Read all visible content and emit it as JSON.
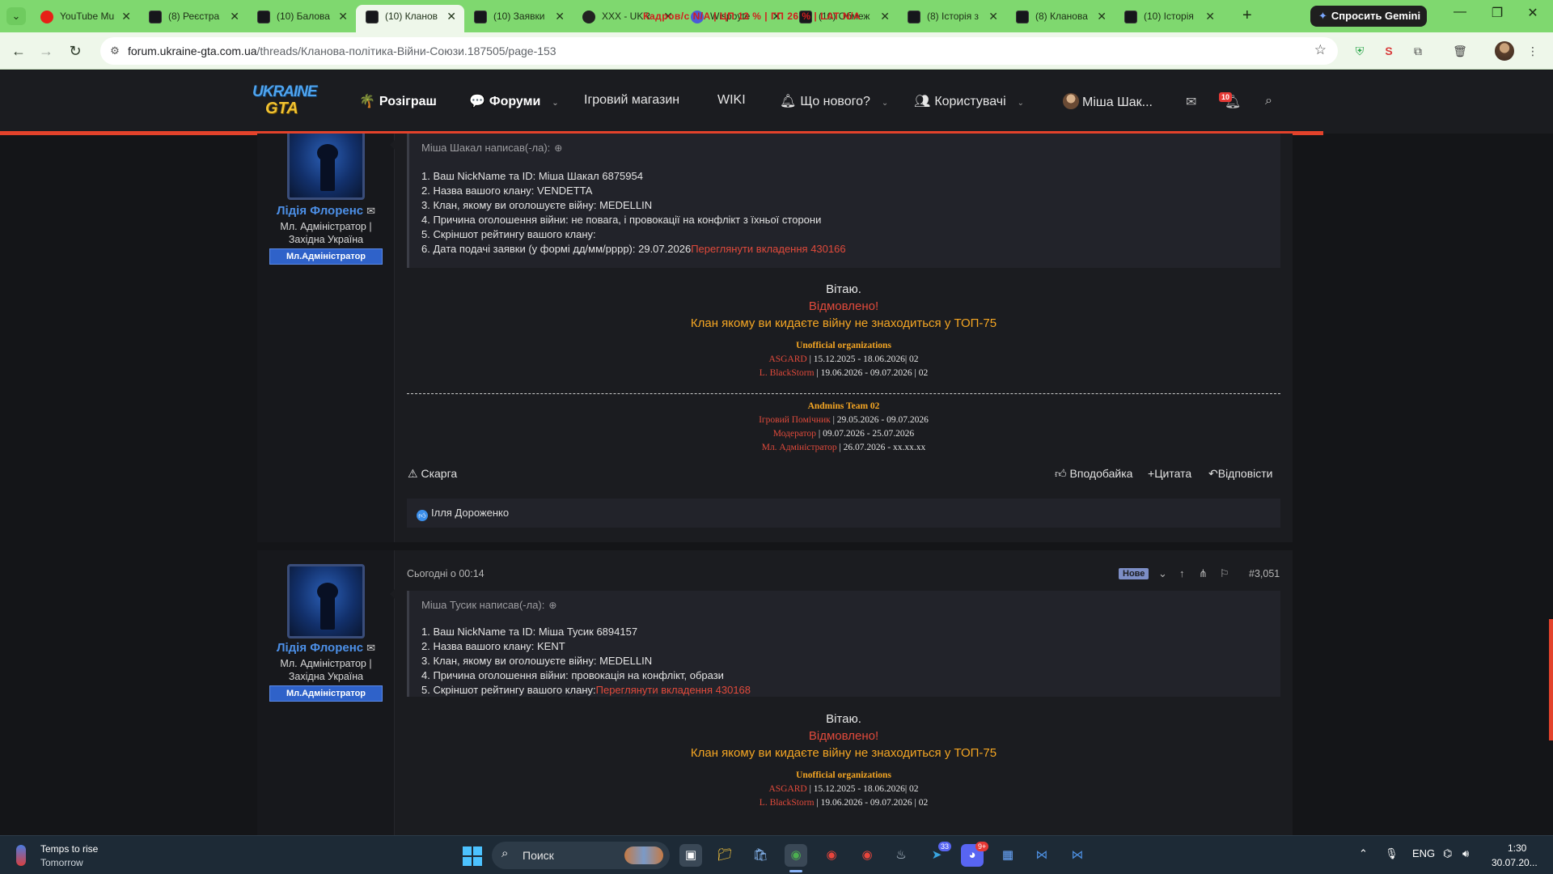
{
  "browser": {
    "tabs": [
      {
        "label": "YouTube Mu",
        "icon": "youtube-icon"
      },
      {
        "label": "(8) Реєстра",
        "icon": "forum-icon"
      },
      {
        "label": "(10) Балова",
        "icon": "forum-icon"
      },
      {
        "label": "(10) Кланов",
        "icon": "forum-icon",
        "active": true
      },
      {
        "label": "(10) Заявки",
        "icon": "forum-icon"
      },
      {
        "label": "XXX - UKR",
        "icon": "github-icon"
      },
      {
        "label": "Wispbyte",
        "icon": "wispbyte-icon"
      },
      {
        "label": "(10) Обмеж",
        "icon": "forum-icon"
      },
      {
        "label": "(8) Історія з",
        "icon": "forum-icon"
      },
      {
        "label": "(8) Кланова",
        "icon": "forum-icon"
      },
      {
        "label": "(10) Історія",
        "icon": "forum-icon"
      }
    ],
    "overlay_text": "Кадров/с  N/A  |  ЦП 13 %  |  ГП 26 %  |  LAT  N/A",
    "gemini_label": "Спросить Gemini",
    "url_domain": "forum.ukraine-gta.com.ua",
    "url_path": "/threads/Кланова-політика-Війни-Союзи.187505/page-153"
  },
  "forum_nav": {
    "logo_top": "UKRAINE",
    "logo_bottom": "GTA",
    "items": [
      {
        "label": "Розіграш",
        "icon": "palm-icon"
      },
      {
        "label": "Форуми",
        "icon": "chat-icon"
      },
      {
        "label": "Ігровий магазин"
      },
      {
        "label": "WIKI"
      },
      {
        "label": "Що нового?",
        "icon": "bell-icon"
      },
      {
        "label": "Користувачі",
        "icon": "users-icon"
      }
    ],
    "username": "Міша Шак...",
    "notifications_count": "10"
  },
  "posts": [
    {
      "author": "Лідія Флоренс",
      "author_title_line1": "Мл. Адміністратор |",
      "author_title_line2": "Західна Україна",
      "banner": "Мл.Адміністратор",
      "quote_header": "Міша Шакал написав(-ла):",
      "quote_lines": [
        "1. Ваш NickName та ID: Міша Шакал 6875954",
        "2. Назва вашого клану: VENDETTA",
        "3. Клан, якому ви оголошуєте війну: MEDELLIN",
        "4. Причина оголошення війни: не повага, і провокації на конфлікт з їхньої сторони",
        "5. Скріншот рейтингу вашого клану:",
        "6. Дата подачі заявки (у формі дд/мм/рррр): 29.07.2026"
      ],
      "attachment_link": "Переглянути вкладення 430166",
      "greeting": "Вітаю.",
      "verdict": "Відмовлено!",
      "reason": "Клан якому ви кидаєте війну не знаходиться у ТОП-75",
      "actions": {
        "report": "Скарга",
        "like": "Вподобайка",
        "quote": "Цитата",
        "reply": "Відповісти"
      },
      "reactions": "Ілля Дороженко"
    },
    {
      "date": "Сьогодні о 00:14",
      "badge": "Нове",
      "number": "#3,051",
      "author": "Лідія Флоренс",
      "author_title_line1": "Мл. Адміністратор |",
      "author_title_line2": "Західна Україна",
      "banner": "Мл.Адміністратор",
      "quote_header": "Міша Тусик написав(-ла):",
      "quote_lines": [
        "1. Ваш NickName та ID: Міша Тусик 6894157",
        "2. Назва вашого клану: KENT",
        "3. Клан, якому ви оголошуєте війну: MEDELLIN",
        "4. Причина оголошення війни: провокація на конфлікт, образи",
        "5. Скріншот рейтингу вашого клану:"
      ],
      "attachment_link": "Переглянути вкладення 430168",
      "greeting": "Вітаю.",
      "verdict": "Відмовлено!",
      "reason": "Клан якому ви кидаєте війну не знаходиться у ТОП-75"
    }
  ],
  "signature": {
    "unofficial_title": "Unofficial organizations",
    "unofficial": [
      {
        "name": "ASGARD",
        "value": " | 15.12.2025 - 18.06.2026| 02"
      },
      {
        "name": "L. BlackStorm",
        "value": " | 19.06.2026 - 09.07.2026 | 02"
      }
    ],
    "admins_title": "Andmins Team 02",
    "admins": [
      {
        "name": "Ігровий Помічник",
        "value": " | 29.05.2026 - 09.07.2026"
      },
      {
        "name": "Модератор",
        "value": " | 09.07.2026 - 25.07.2026"
      },
      {
        "name": "Мл. Адміністратор",
        "value": " | 26.07.2026 - xx.xx.xx"
      }
    ]
  },
  "taskbar": {
    "weather_line1": "Temps to rise",
    "weather_line2": "Tomorrow",
    "search_placeholder": "Поиск",
    "telegram_badge": "33",
    "discord_badge": "9+",
    "lang": "ENG",
    "time": "1:30",
    "date": "30.07.20..."
  }
}
